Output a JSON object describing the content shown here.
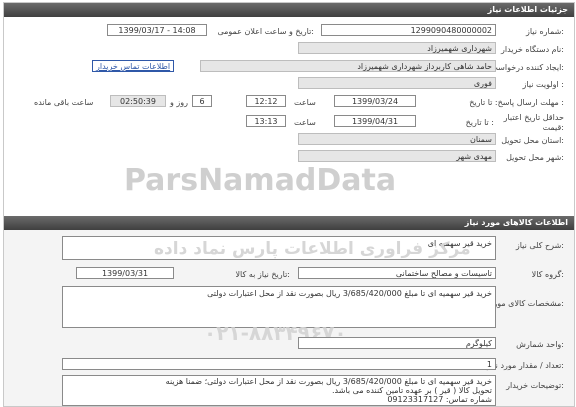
{
  "header": {
    "title": "جزئیات اطلاعات نیاز"
  },
  "need_number": {
    "label": "شماره نیاز:",
    "value": "1299090480000002"
  },
  "announce_date": {
    "label": "تاریخ و ساعت اعلان عمومی:",
    "value": "1399/03/17 - 14:08"
  },
  "buyer_org": {
    "label": "نام دستگاه خریدار:",
    "value": "شهرداری شهمیرزاد"
  },
  "creator": {
    "label": "ایجاد کننده درخواست:",
    "value": "حامد شاهی کاربرداز شهرداری شهمیرزاد",
    "contact_link": "اطلاعات تماس خریدار"
  },
  "priority": {
    "label": "اولویت نیاز :",
    "value": "فوری"
  },
  "reply_deadline": {
    "label": "مهلت ارسال پاسخ: تا تاریخ :",
    "date": "1399/03/24",
    "time_label": "ساعت",
    "time": "12:12",
    "days": "6",
    "days_label": "روز و",
    "remaining": "02:50:39",
    "remaining_label": "ساعت باقی مانده"
  },
  "price_validity": {
    "label1": "حداقل تاریخ اعتبار",
    "label2": "قیمت:",
    "to_date_label": "تا تاریخ :",
    "date": "1399/04/31",
    "time_label": "ساعت",
    "time": "13:13"
  },
  "province": {
    "label": "استان محل تحویل:",
    "value": "سمنان"
  },
  "city": {
    "label": "شهر محل تحویل:",
    "value": "مهدی شهر"
  },
  "goods_section": {
    "title": "اطلاعات کالاهای مورد نیاز"
  },
  "summary": {
    "label": "شرح کلی نیاز:",
    "value": "خرید قیر سهمیه ای"
  },
  "goods_group": {
    "label": "گروه کالا:",
    "value": "تاسیسات و مصالح ساختمانی",
    "need_date_label": "تاریخ نیاز به کالا:",
    "need_date": "1399/03/31"
  },
  "specs": {
    "label": "مشخصات کالای مورد نیاز:",
    "value": "خرید قیر سهمیه ای تا مبلغ 3/685/420/000 ریال بصورت نقد از محل اعتبارات دولتی"
  },
  "unit": {
    "label": "واحد شمارش:",
    "value": "کیلوگرم"
  },
  "quantity": {
    "label": "تعداد / مقدار مورد نیاز:",
    "value": "1"
  },
  "buyer_notes": {
    "label1": "توضیحات خریدار:",
    "lines": [
      "خرید قیر سهمیه ای تا مبلغ 3/685/420/000 ریال بصورت نقد از محل اعتبارات دولتی؛ ضمنا هزینه",
      "تحویل کالا ( قیر ) بر عهده تامین کننده می باشد.",
      "شماره تماس: 09123317127"
    ]
  },
  "watermark": {
    "text1": "ParsNamadData",
    "text2": "مرکز فراوری اطلاعات پارس نماد داده",
    "text3": "۰۲۱-۸۸۳۴۹۶۷۰"
  }
}
